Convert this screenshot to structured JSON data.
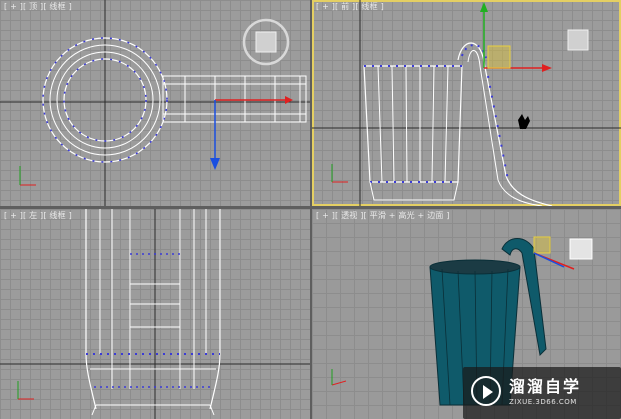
{
  "viewports": {
    "top": {
      "label": "[ + ][ 顶 ][ 线框 ]"
    },
    "front": {
      "label": "[ + ][ 前 ][ 线框 ]"
    },
    "left": {
      "label": "[ + ][ 左 ][ 线框 ]"
    },
    "perspective": {
      "label": "[ + ][ 透视 ][ 平滑 + 高光 + 边面 ]"
    }
  },
  "watermark": {
    "title": "溜溜自学",
    "url": "ZIXUE.3D66.COM"
  },
  "colors": {
    "active_border": "#e4cf63",
    "viewport_bg": "#9c9c9c",
    "wire": "#ffffff",
    "vertex": "#3b3bd6",
    "mug": "#0f5a6a"
  }
}
